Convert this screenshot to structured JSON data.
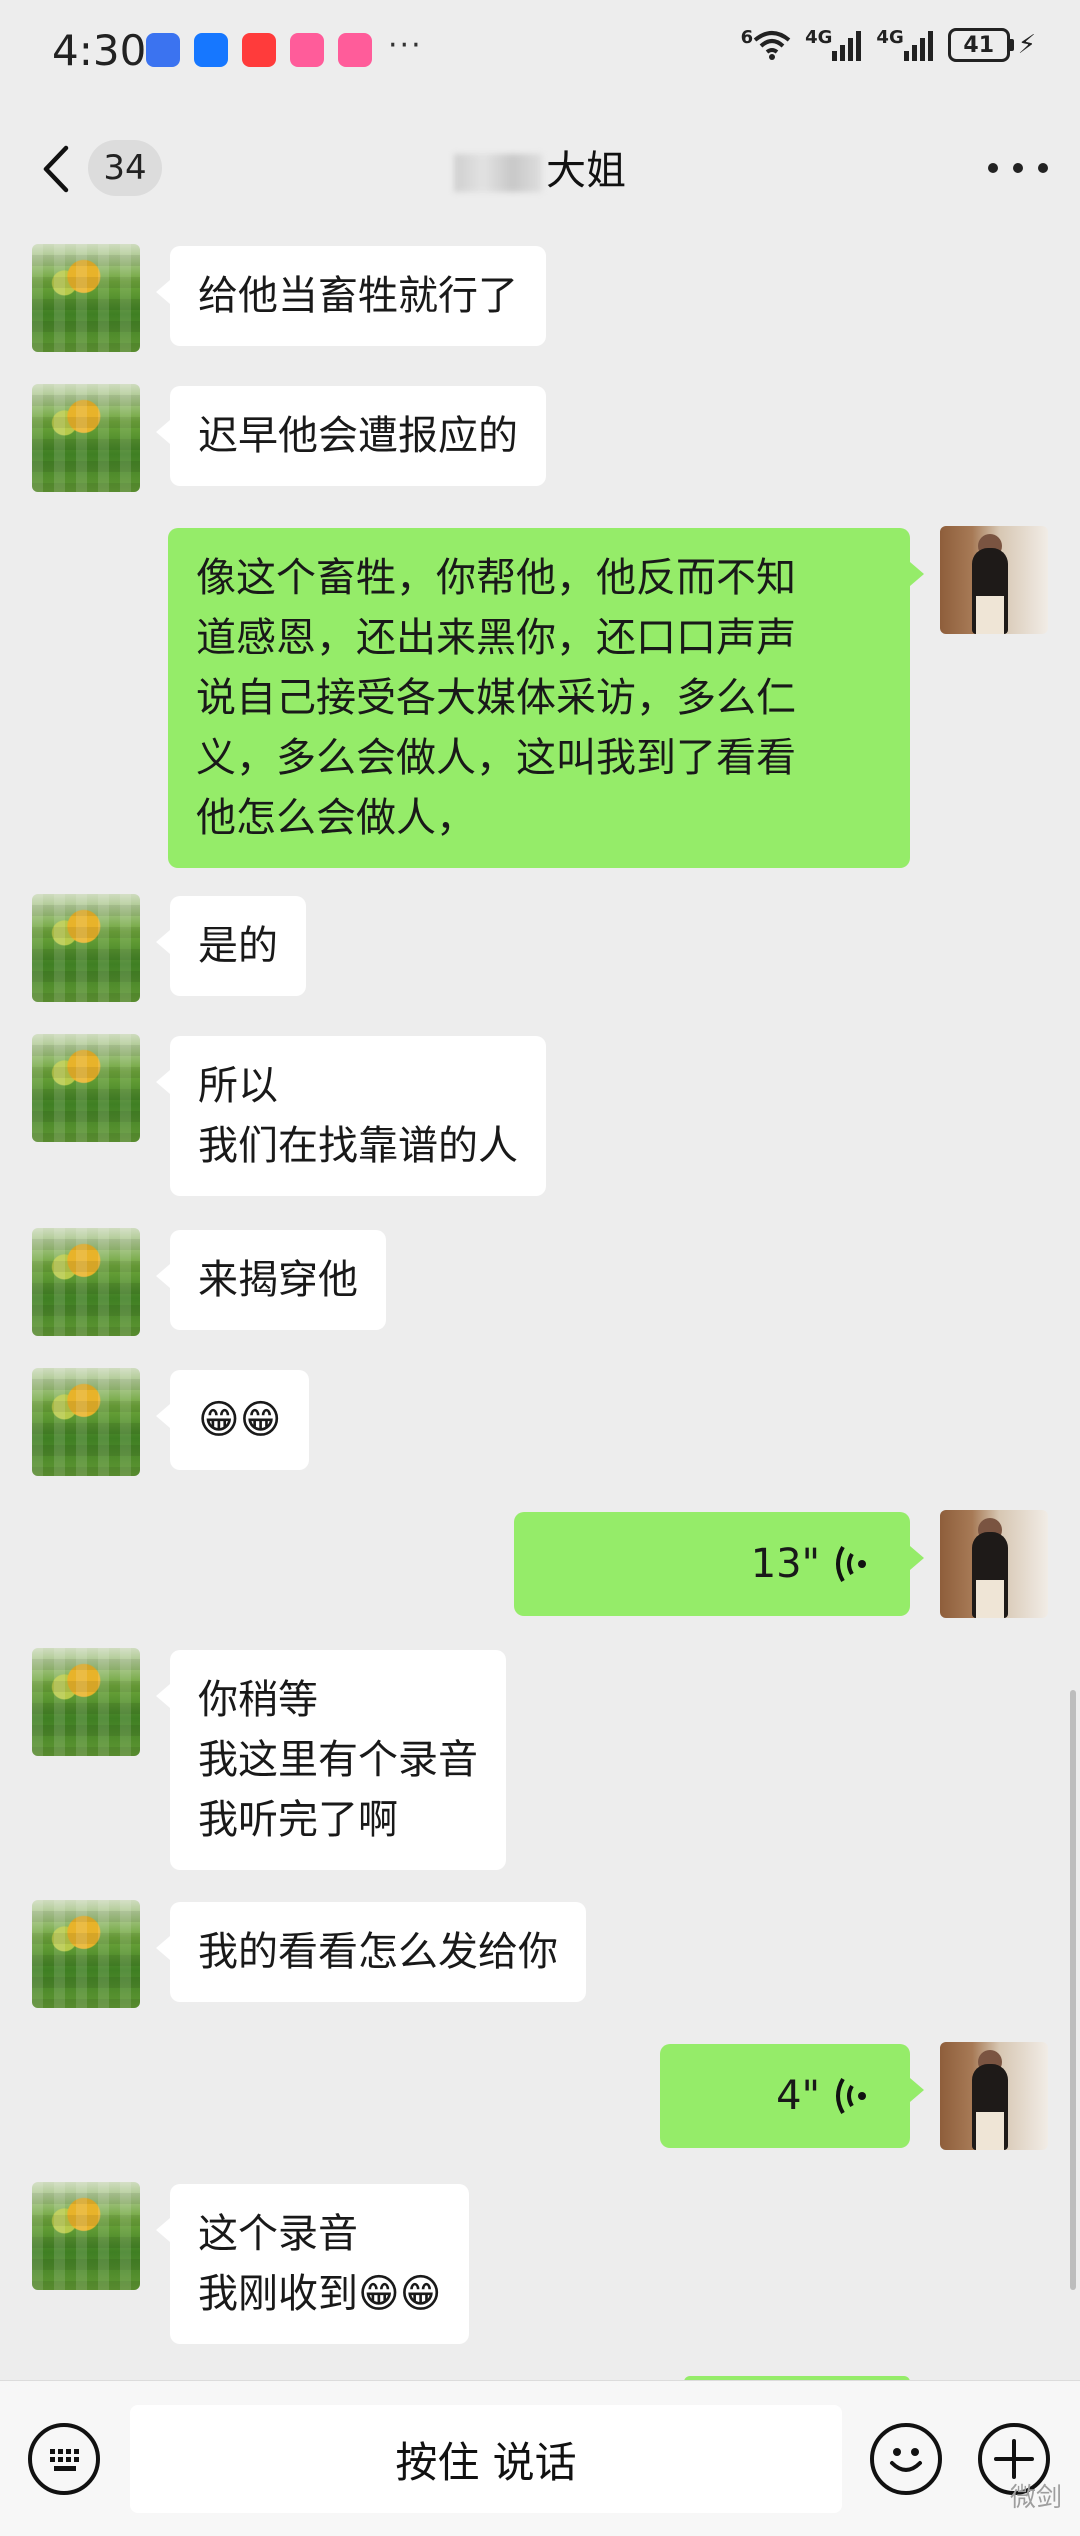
{
  "status_bar": {
    "time": "4:30",
    "more": "···",
    "wifi_label": "6",
    "sim1_label": "4G",
    "sim2_label": "4G",
    "battery": "41"
  },
  "header": {
    "back_badge": "34",
    "title": "大姐"
  },
  "messages": [
    {
      "side": "other",
      "text": "给他当畜牲就行了"
    },
    {
      "side": "other",
      "text": "迟早他会遭报应的"
    },
    {
      "side": "self",
      "text": "像这个畜牲，你帮他，他反而不知\n道感恩，还出来黑你，还口口声声\n说自己接受各大媒体采访，多么仁\n义，多么会做人，这叫我到了看看\n他怎么会做人，"
    },
    {
      "side": "other",
      "text": "是的"
    },
    {
      "side": "other",
      "text": "所以\n我们在找靠谱的人"
    },
    {
      "side": "other",
      "text": "来揭穿他"
    },
    {
      "side": "other",
      "text": "😁😁"
    },
    {
      "side": "self",
      "voice": "13\""
    },
    {
      "side": "other",
      "text": "你稍等\n我这里有个录音\n我听完了啊"
    },
    {
      "side": "other",
      "text": "我的看看怎么发给你"
    },
    {
      "side": "self",
      "voice": "4\""
    },
    {
      "side": "other",
      "text": "这个录音\n我刚收到😁😁"
    }
  ],
  "input_bar": {
    "hold_to_talk": "按住 说话",
    "watermark": "微剑"
  },
  "colors": {
    "background": "#ededed",
    "self_bubble": "#95ec69",
    "other_bubble": "#ffffff"
  },
  "icons": [
    "back-arrow-icon",
    "more-dots-icon",
    "keyboard-icon",
    "emoji-icon",
    "plus-icon",
    "voice-wave-icon"
  ]
}
